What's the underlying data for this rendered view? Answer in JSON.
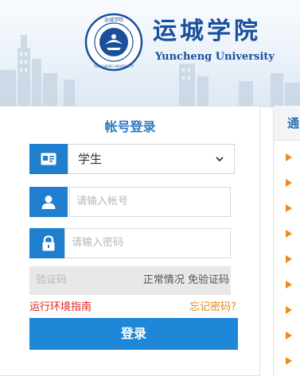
{
  "banner": {
    "school_name_cn": "运城学院",
    "school_name_en": "Yuncheng University",
    "logo_text_top": "运城学院",
    "logo_text_bottom": "YUNCHENG UNIVERSITY"
  },
  "login": {
    "title": "帐号登录",
    "role_selected": "学生",
    "account_placeholder": "请输入帐号",
    "password_placeholder": "请输入密码",
    "captcha_placeholder": "验证码",
    "captcha_status": "正常情况 免验证码",
    "guide_link": "运行环境指南",
    "forgot_link": "忘记密码?",
    "submit_label": "登录"
  },
  "notice": {
    "title_fragment": "通",
    "items_count": 9
  },
  "colors": {
    "brand_blue": "#1f7fce",
    "link_red": "#e1221f",
    "link_orange": "#e6841b",
    "arrow_orange": "#f08a1c"
  }
}
